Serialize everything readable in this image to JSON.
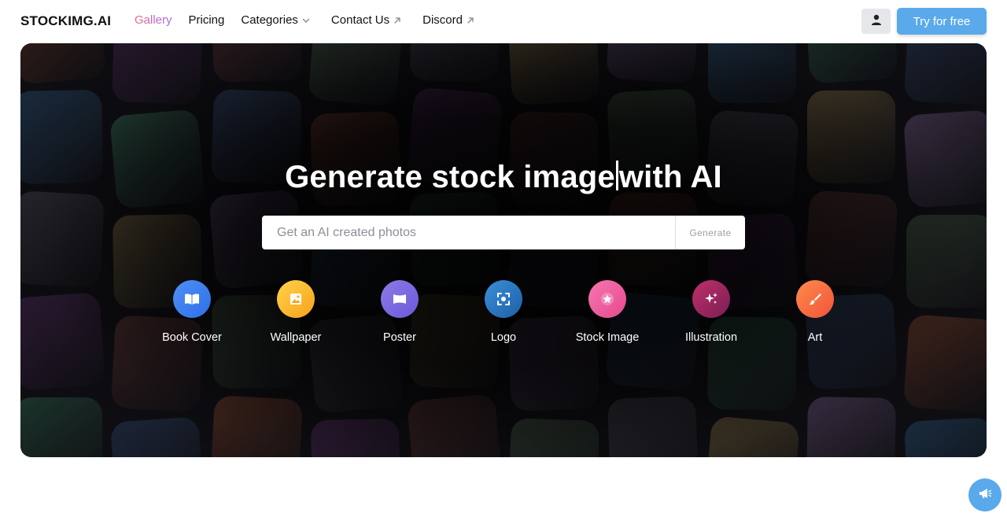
{
  "brand": {
    "name": "STOCKIMG.AI"
  },
  "nav": {
    "links": [
      {
        "label": "Gallery"
      },
      {
        "label": "Pricing"
      },
      {
        "label": "Categories",
        "icon": "chevron-down-icon"
      },
      {
        "label": "Contact Us",
        "icon": "external-arrow-icon"
      },
      {
        "label": "Discord",
        "icon": "external-arrow-icon"
      }
    ],
    "user_icon": "user-icon",
    "cta_label": "Try for free"
  },
  "hero": {
    "title_left": "Generate stock image",
    "title_right": "with AI",
    "search": {
      "placeholder": "Get an AI created photos",
      "value": "",
      "button_label": "Generate"
    },
    "categories": [
      {
        "label": "Book Cover",
        "icon": "book-icon",
        "colors": [
          "#4f8ff7",
          "#2e6fe6"
        ]
      },
      {
        "label": "Wallpaper",
        "icon": "image-icon",
        "colors": [
          "#ffd24a",
          "#f7a21b"
        ]
      },
      {
        "label": "Poster",
        "icon": "poster-icon",
        "colors": [
          "#8d7ae8",
          "#6a5ad8"
        ]
      },
      {
        "label": "Logo",
        "icon": "focus-icon",
        "colors": [
          "#3a8fd8",
          "#1e5fa8"
        ]
      },
      {
        "label": "Stock Image",
        "icon": "star-icon",
        "colors": [
          "#f776b0",
          "#e54a8f"
        ]
      },
      {
        "label": "Illustration",
        "icon": "sparkles-icon",
        "colors": [
          "#c0306a",
          "#7a1d55"
        ]
      },
      {
        "label": "Art",
        "icon": "brush-icon",
        "colors": [
          "#ff8a4a",
          "#f0553a"
        ]
      }
    ]
  },
  "colors": {
    "accent": "#5aa9ea",
    "gallery_gradient": [
      "#f0648a",
      "#9b6cf0"
    ]
  },
  "fab": {
    "icon": "megaphone-icon"
  }
}
